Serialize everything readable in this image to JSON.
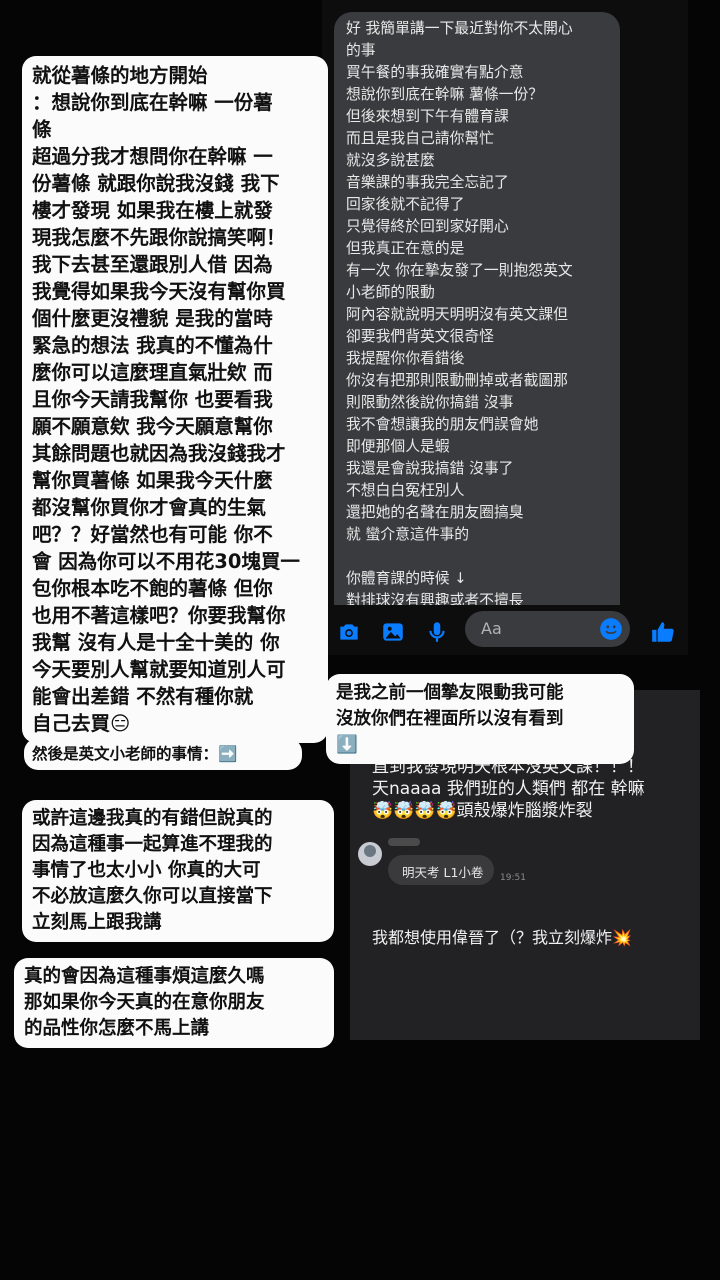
{
  "chat_screenshot": {
    "message": "好 我簡單講一下最近對你不太開心\n的事\n買午餐的事我確實有點介意\n想說你到底在幹嘛 薯條一份？\n但後來想到下午有體育課\n而且是我自己請你幫忙\n就沒多說甚麼\n音樂課的事我完全忘記了\n回家後就不記得了\n只覺得終於回到家好開心\n但我真正在意的是\n有一次 你在摯友發了一則抱怨英文\n小老師的限動\n阿內容就說明天明明沒有英文課但\n卻要我們背英文很奇怪\n我提醒你你看錯後\n你沒有把那則限動刪掉或者截圖那\n則限動然後說你搞錯 沒事\n我不會想讓我的朋友們誤會她\n即便那個人是蝦\n我還是會說我搞錯 沒事了\n不想白白冤枉別人\n還把她的名聲在朋友圈搞臭\n就 蠻介意這件事的\n\n你體育課的時候 ↓\n對排球沒有興趣或者不擅長",
    "composer": {
      "placeholder": "Aa",
      "icons": [
        "camera-icon",
        "image-icon",
        "mic-icon",
        "emoji-icon",
        "like-icon"
      ],
      "accent_color": "#0a7cff"
    }
  },
  "story_screenshot": {
    "line1": "直到我發現明天根本沒英文課！！！",
    "line2": "天naaaa 我們班的人類們 都在 幹嘛",
    "line3": "🤯🤯🤯🤯頭殼爆炸腦漿炸裂",
    "quiz_message": "明天考 L1小卷",
    "quiz_time": "19:51",
    "last_line": "我都想使用偉晉了（？我立刻爆炸💥"
  },
  "annotations": {
    "main": "就從薯條的地方開始\n：想說你到底在幹嘛 一份薯\n條\n超過分我才想問你在幹嘛 一\n份薯條 就跟你說我沒錢 我下\n樓才發現 如果我在樓上就發\n現我怎麼不先跟你說搞笑啊！\n我下去甚至還跟別人借 因為\n我覺得如果我今天沒有幫你買\n個什麼更沒禮貌 是我的當時\n緊急的想法 我真的不懂為什\n麼你可以這麼理直氣壯欸 而\n且你今天請我幫你 也要看我\n願不願意欸 我今天願意幫你\n其餘問題也就因為我沒錢我才\n幫你買薯條 如果我今天什麼\n都沒幫你買你才會真的生氣\n吧？？好當然也有可能 你不\n會 因為你可以不用花30塊買一\n包你根本吃不飽的薯條 但你\n也用不著這樣吧？你要我幫你\n我幫 沒有人是十全十美的 你\n今天要別人幫就要知道別人可\n能會出差錯 不然有種你就\n自己去買😑",
    "reply_right": "是我之前一個摯友限動我可能\n沒放你們在裡面所以沒有看到\n⬇️",
    "english_teacher": "然後是英文小老師的事情：➡️",
    "maybe": "或許這邊我真的有錯但說真的\n因為這種事一起算進不理我的\n事情了也太小小 你真的大可\n不必放這麼久你可以直接當下\n立刻馬上跟我講",
    "really": "真的會因為這種事煩這麼久嗎\n那如果你今天真的在意你朋友\n的品性你怎麼不馬上講"
  }
}
